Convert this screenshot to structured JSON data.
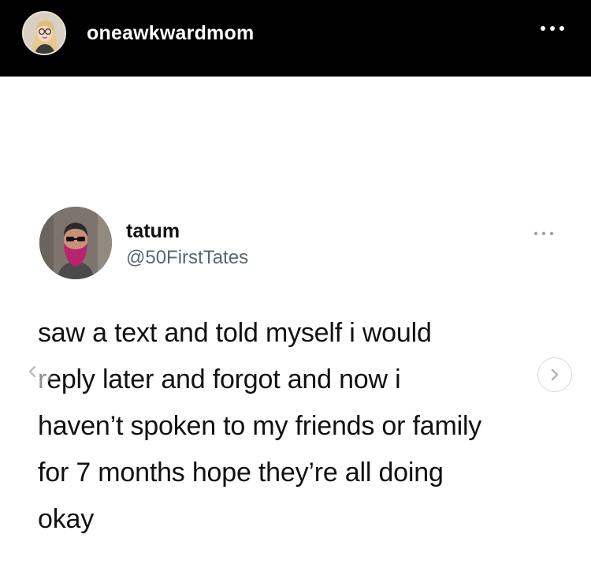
{
  "instagram": {
    "username": "oneawkwardmom",
    "avatar_icon": "cartoon-woman-avatar-icon",
    "more_icon": "more-options-icon"
  },
  "tweet": {
    "name": "tatum",
    "handle": "@50FirstTates",
    "avatar_icon": "bearded-man-avatar-icon",
    "more_icon": "more-options-icon",
    "text_lines": [
      "saw a text and told myself i would",
      "reply later and forgot and now i",
      "haven’t spoken to my friends or family",
      "for 7 months hope they’re all doing",
      "okay"
    ]
  },
  "carousel": {
    "prev_icon": "chevron-left-icon",
    "next_icon": "chevron-right-icon"
  },
  "colors": {
    "header_bg": "#000000",
    "header_text": "#ffffff",
    "body_bg": "#ffffff",
    "handle_gray": "#5b6670",
    "text": "#111111"
  }
}
